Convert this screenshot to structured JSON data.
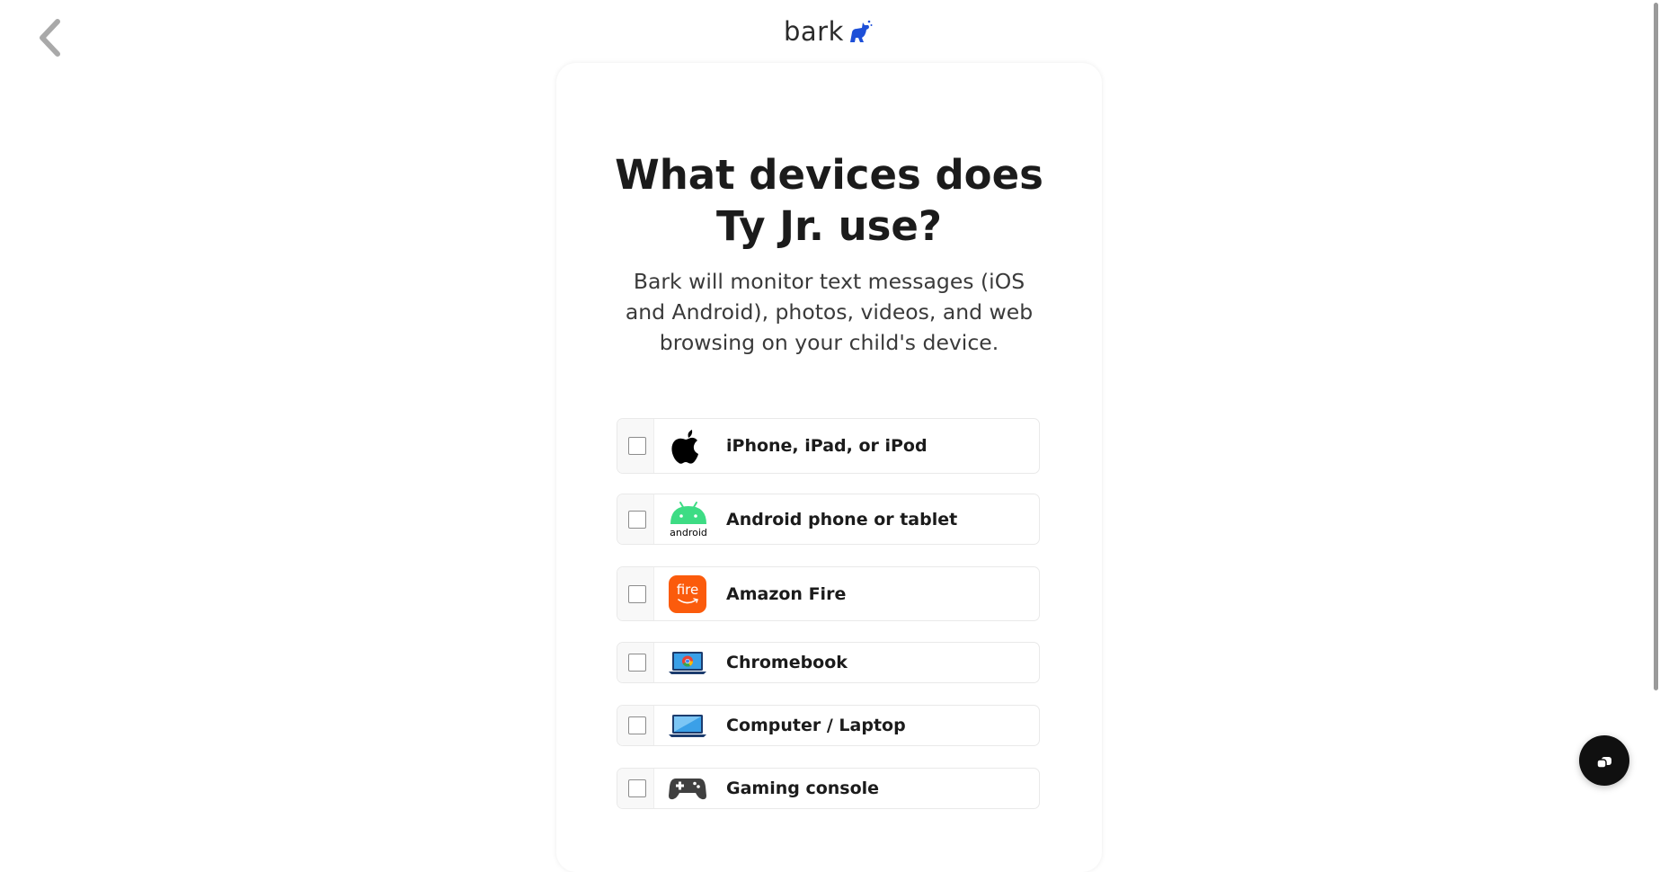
{
  "header": {
    "brand": "bark",
    "back_icon": "chevron-left-icon",
    "logo_icon": "dog-icon",
    "brand_color": "#1d4fd8"
  },
  "question": {
    "title_line1": "What devices does",
    "title_line2": "Ty Jr. use?",
    "subtitle": "Bark will monitor text messages (iOS and Android), photos, videos, and web browsing on your child's device."
  },
  "devices": [
    {
      "label": "iPhone, iPad, or iPod",
      "icon": "apple-icon",
      "checked": false
    },
    {
      "label": "Android phone or tablet",
      "icon": "android-icon",
      "icon_text": "android",
      "checked": false
    },
    {
      "label": "Amazon Fire",
      "icon": "amazon-fire-icon",
      "icon_text": "fire",
      "checked": false
    },
    {
      "label": "Chromebook",
      "icon": "chromebook-icon",
      "checked": false
    },
    {
      "label": "Computer / Laptop",
      "icon": "laptop-icon",
      "checked": false
    },
    {
      "label": "Gaming console",
      "icon": "gamepad-icon",
      "checked": false
    }
  ],
  "chat": {
    "icon": "chat-bubble-icon"
  }
}
